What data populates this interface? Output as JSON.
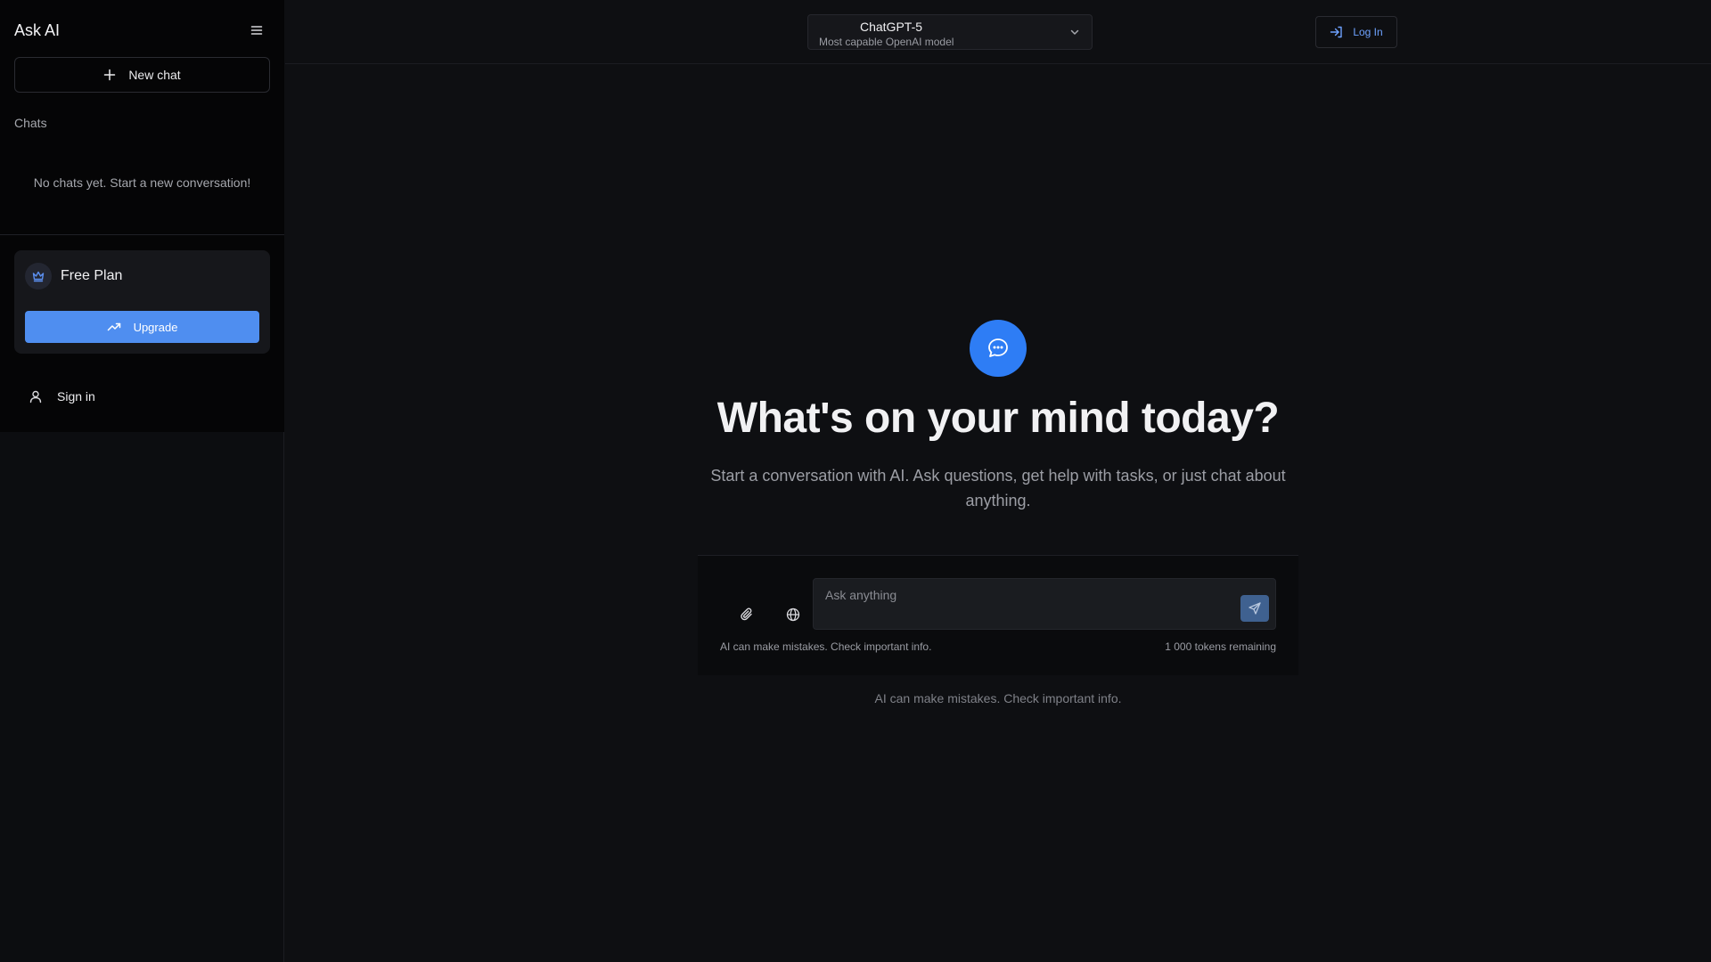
{
  "sidebar": {
    "brand": "Ask AI",
    "new_chat_label": "New chat",
    "chats_label": "Chats",
    "empty_text": "No chats yet. Start a new conversation!",
    "plan": {
      "title": "Free Plan",
      "upgrade_label": "Upgrade"
    },
    "signin_label": "Sign in"
  },
  "topbar": {
    "model": {
      "name": "ChatGPT-5",
      "description": "Most capable OpenAI model"
    },
    "login_label": "Log In"
  },
  "hero": {
    "title": "What's on your mind today?",
    "subtitle": "Start a conversation with AI. Ask questions, get help with tasks, or just chat about anything."
  },
  "composer": {
    "placeholder": "Ask anything",
    "value": "",
    "disclaimer": "AI can make mistakes. Check important info.",
    "tokens": "1 000 tokens remaining"
  },
  "footer": {
    "disclaimer": "AI can make mistakes. Check important info."
  },
  "icons": {
    "menu": "menu-icon",
    "plus": "plus-icon",
    "crown": "crown-icon",
    "trend": "trending-up-icon",
    "user": "user-icon",
    "chevron": "chevron-down-icon",
    "login": "log-in-icon",
    "chat": "chat-bubble-icon",
    "attach": "paperclip-icon",
    "globe": "globe-icon",
    "send": "send-icon"
  },
  "colors": {
    "accent": "#4f8ef0",
    "hero_icon": "#2e7df5",
    "send_button": "#3f6190",
    "login_text": "#6ea2ff",
    "background": "#0e0f12",
    "sidebar_panel": "#050506"
  }
}
